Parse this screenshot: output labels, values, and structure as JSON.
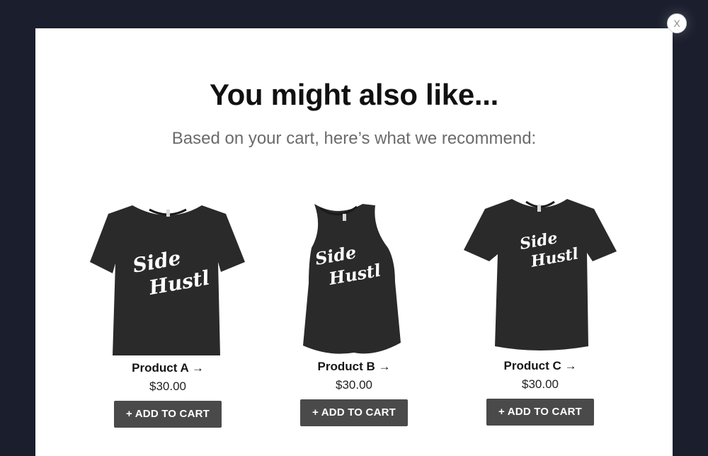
{
  "modal": {
    "close_label": "X",
    "title": "You might also like...",
    "subtitle": "Based on your cart, here’s what we recommend:"
  },
  "products": [
    {
      "name": "Product A →",
      "price": "$30.00",
      "button": "+ ADD TO CART",
      "image": "tshirt-icon",
      "print": "Side Hustl"
    },
    {
      "name": "Product B →",
      "price": "$30.00",
      "button": "+ ADD TO CART",
      "image": "tank-top-icon",
      "print": "Side Hustl"
    },
    {
      "name": "Product C →",
      "price": "$30.00",
      "button": "+ ADD TO CART",
      "image": "tshirt-icon",
      "print": "Side Hustl"
    }
  ],
  "colors": {
    "backdrop": "#1a1e2d",
    "button": "#4a4a4a",
    "garment": "#2a2a2a"
  }
}
